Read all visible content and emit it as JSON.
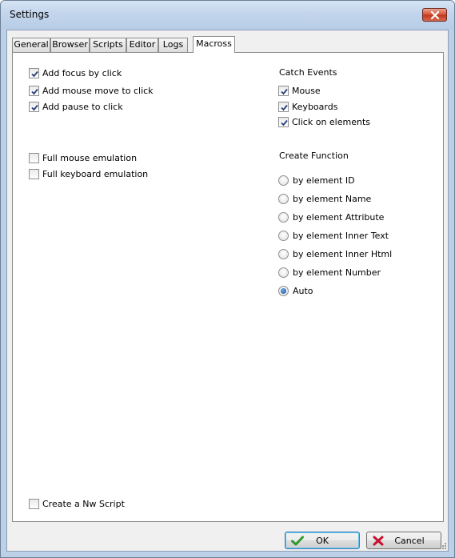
{
  "window": {
    "title": "Settings"
  },
  "tabs": [
    "General",
    "Browser",
    "Scripts",
    "Editor",
    "Logs",
    "Macross"
  ],
  "left_options": [
    {
      "label": "Add focus by click",
      "checked": true
    },
    {
      "label": "Add mouse move to click",
      "checked": true
    },
    {
      "label": "Add pause to click",
      "checked": true
    },
    {
      "label": "Full mouse emulation",
      "checked": false
    },
    {
      "label": "Full keyboard emulation",
      "checked": false
    }
  ],
  "catch_events": {
    "title": "Catch Events",
    "items": [
      {
        "label": "Mouse",
        "checked": true
      },
      {
        "label": "Keyboards",
        "checked": true
      },
      {
        "label": "Click on elements",
        "checked": true
      }
    ]
  },
  "create_function": {
    "title": "Create Function",
    "options": [
      {
        "label": "by element ID",
        "selected": false
      },
      {
        "label": "by element Name",
        "selected": false
      },
      {
        "label": "by element Attribute",
        "selected": false
      },
      {
        "label": "by element Inner Text",
        "selected": false
      },
      {
        "label": "by element Inner Html",
        "selected": false
      },
      {
        "label": "by element Number",
        "selected": false
      },
      {
        "label": "Auto",
        "selected": true
      }
    ]
  },
  "nw_script": {
    "label": "Create a Nw Script",
    "checked": false
  },
  "buttons": {
    "ok": "OK",
    "cancel": "Cancel"
  },
  "colors": {
    "ok_check": "#2f9a2f",
    "cancel_x": "#c8102e",
    "close_button": "#c8452b"
  }
}
